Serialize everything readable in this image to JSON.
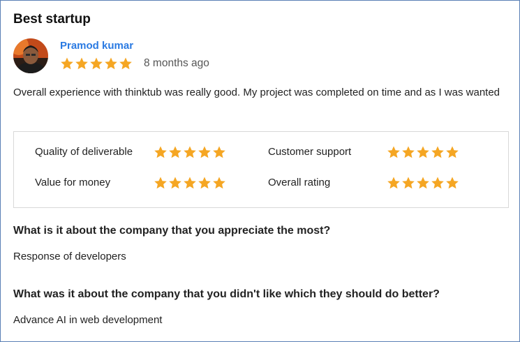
{
  "review": {
    "title": "Best startup",
    "reviewer_name": "Pramod kumar",
    "rating": 5,
    "time_ago": "8 months ago",
    "body": "Overall experience with thinktub was really good. My project was completed on time and as I was wanted"
  },
  "ratings": [
    {
      "label": "Quality of deliverable",
      "stars": 5
    },
    {
      "label": "Customer support",
      "stars": 5
    },
    {
      "label": "Value for money",
      "stars": 5
    },
    {
      "label": "Overall rating",
      "stars": 5
    }
  ],
  "questions": [
    {
      "question": "What is it about the company that you appreciate the most?",
      "answer": "Response of developers"
    },
    {
      "question": "What was it about the company that you didn't like which they should do better?",
      "answer": "Advance AI in web development"
    }
  ],
  "colors": {
    "accent": "#2a7ae2",
    "star": "#f5a623",
    "border": "#d8d8d8"
  }
}
